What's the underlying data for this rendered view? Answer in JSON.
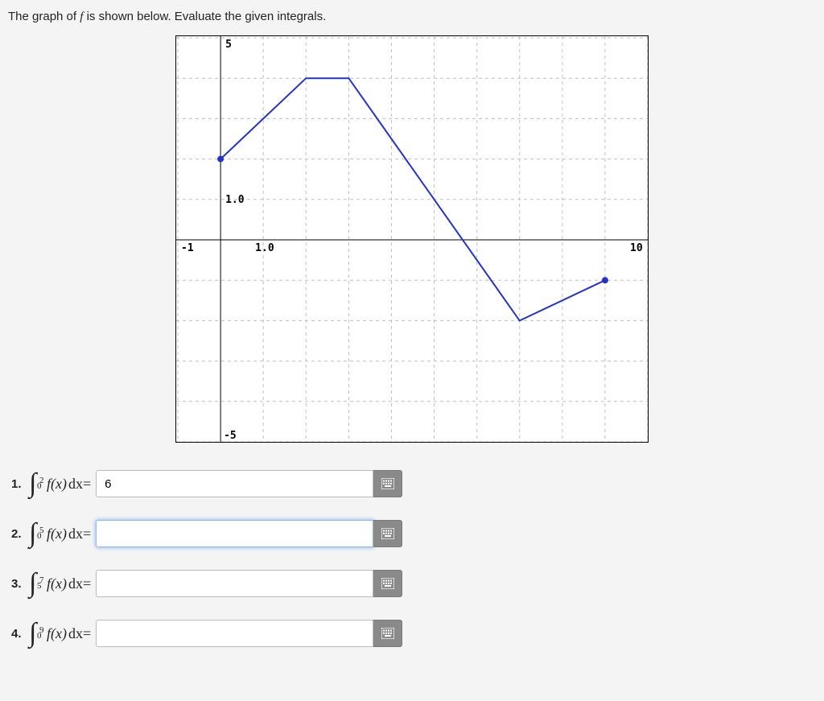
{
  "prompt": {
    "before": "The graph of ",
    "sym": "f",
    "after": " is shown below. Evaluate the given integrals."
  },
  "chart_data": {
    "type": "line",
    "x": [
      0,
      2,
      3,
      7,
      9
    ],
    "y": [
      2,
      4,
      4,
      -2,
      -1
    ],
    "endpoints": {
      "left_open": false,
      "right_closed": true
    },
    "x_axis": {
      "min": -1,
      "max": 10,
      "ticks_shown": [
        -1,
        10
      ],
      "label_at_one": "1.0"
    },
    "y_axis": {
      "min": -5,
      "max": 5,
      "ticks_shown": [
        5,
        -5
      ],
      "label_at_one": "1.0"
    },
    "grid": true,
    "title": "",
    "xlabel": "",
    "ylabel": ""
  },
  "questions": [
    {
      "n": "1.",
      "lower": "0",
      "upper": "2",
      "value": "6",
      "focused": false
    },
    {
      "n": "2.",
      "lower": "0",
      "upper": "5",
      "value": "",
      "focused": true
    },
    {
      "n": "3.",
      "lower": "5",
      "upper": "7",
      "value": "",
      "focused": false
    },
    {
      "n": "4.",
      "lower": "0",
      "upper": "9",
      "value": "",
      "focused": false
    }
  ],
  "labels": {
    "fx": "f(x)",
    "dx": " dx",
    "eq": " = "
  }
}
